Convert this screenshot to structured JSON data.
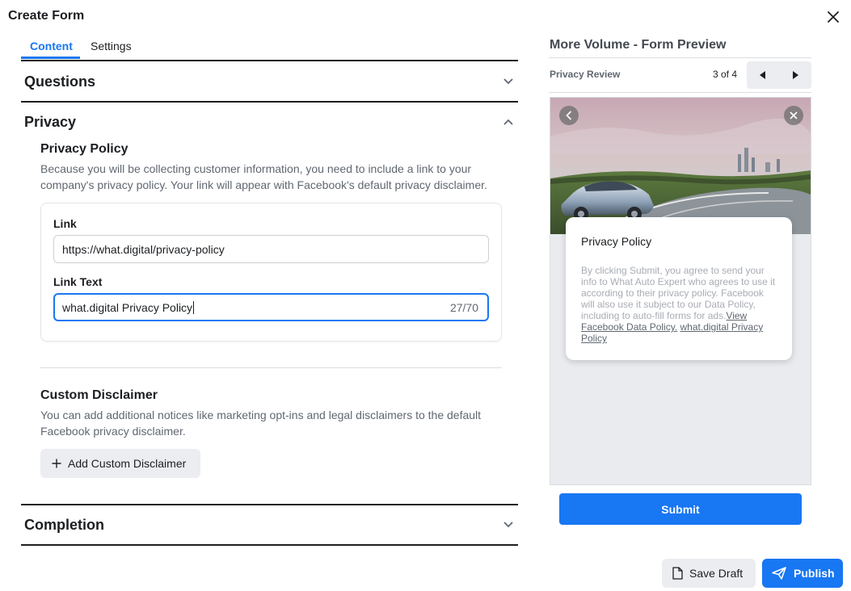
{
  "dialog": {
    "title": "Create Form",
    "close_icon": "close-icon"
  },
  "tabs": [
    {
      "label": "Content",
      "active": true
    },
    {
      "label": "Settings",
      "active": false
    }
  ],
  "sections": {
    "questions": {
      "label": "Questions",
      "expanded": false
    },
    "privacy": {
      "label": "Privacy",
      "expanded": true
    },
    "completion": {
      "label": "Completion",
      "expanded": false
    }
  },
  "privacy_policy": {
    "title": "Privacy Policy",
    "description": "Because you will be collecting customer information, you need to include a link to your company's privacy policy. Your link will appear with Facebook's default privacy disclaimer.",
    "link_label": "Link",
    "link_value": "https://what.digital/privacy-policy",
    "link_text_label": "Link Text",
    "link_text_value": "what.digital Privacy Policy",
    "link_text_counter": "27/70"
  },
  "custom_disclaimer": {
    "title": "Custom Disclaimer",
    "description": "You can add additional notices like marketing opt-ins and legal disclaimers to the default Facebook privacy disclaimer.",
    "button_label": "Add Custom Disclaimer"
  },
  "preview": {
    "title": "More Volume - Form Preview",
    "screen_label": "Privacy Review",
    "page_count": "3 of 4",
    "card_title": "Privacy Policy",
    "card_body": "By clicking Submit, you agree to send your info to What Auto Expert who agrees to use it according to their privacy policy. Facebook will also use it subject to our Data Policy, including to auto-fill forms for ads.",
    "card_link_1": "View Facebook Data Policy.",
    "card_link_2": "what.digital Privacy Policy",
    "submit_label": "Submit"
  },
  "footer": {
    "save_draft_label": "Save Draft",
    "publish_label": "Publish"
  },
  "colors": {
    "accent": "#1877f2",
    "text": "#1c1e21",
    "muted": "#606770",
    "button_gray": "#ebedf0"
  }
}
